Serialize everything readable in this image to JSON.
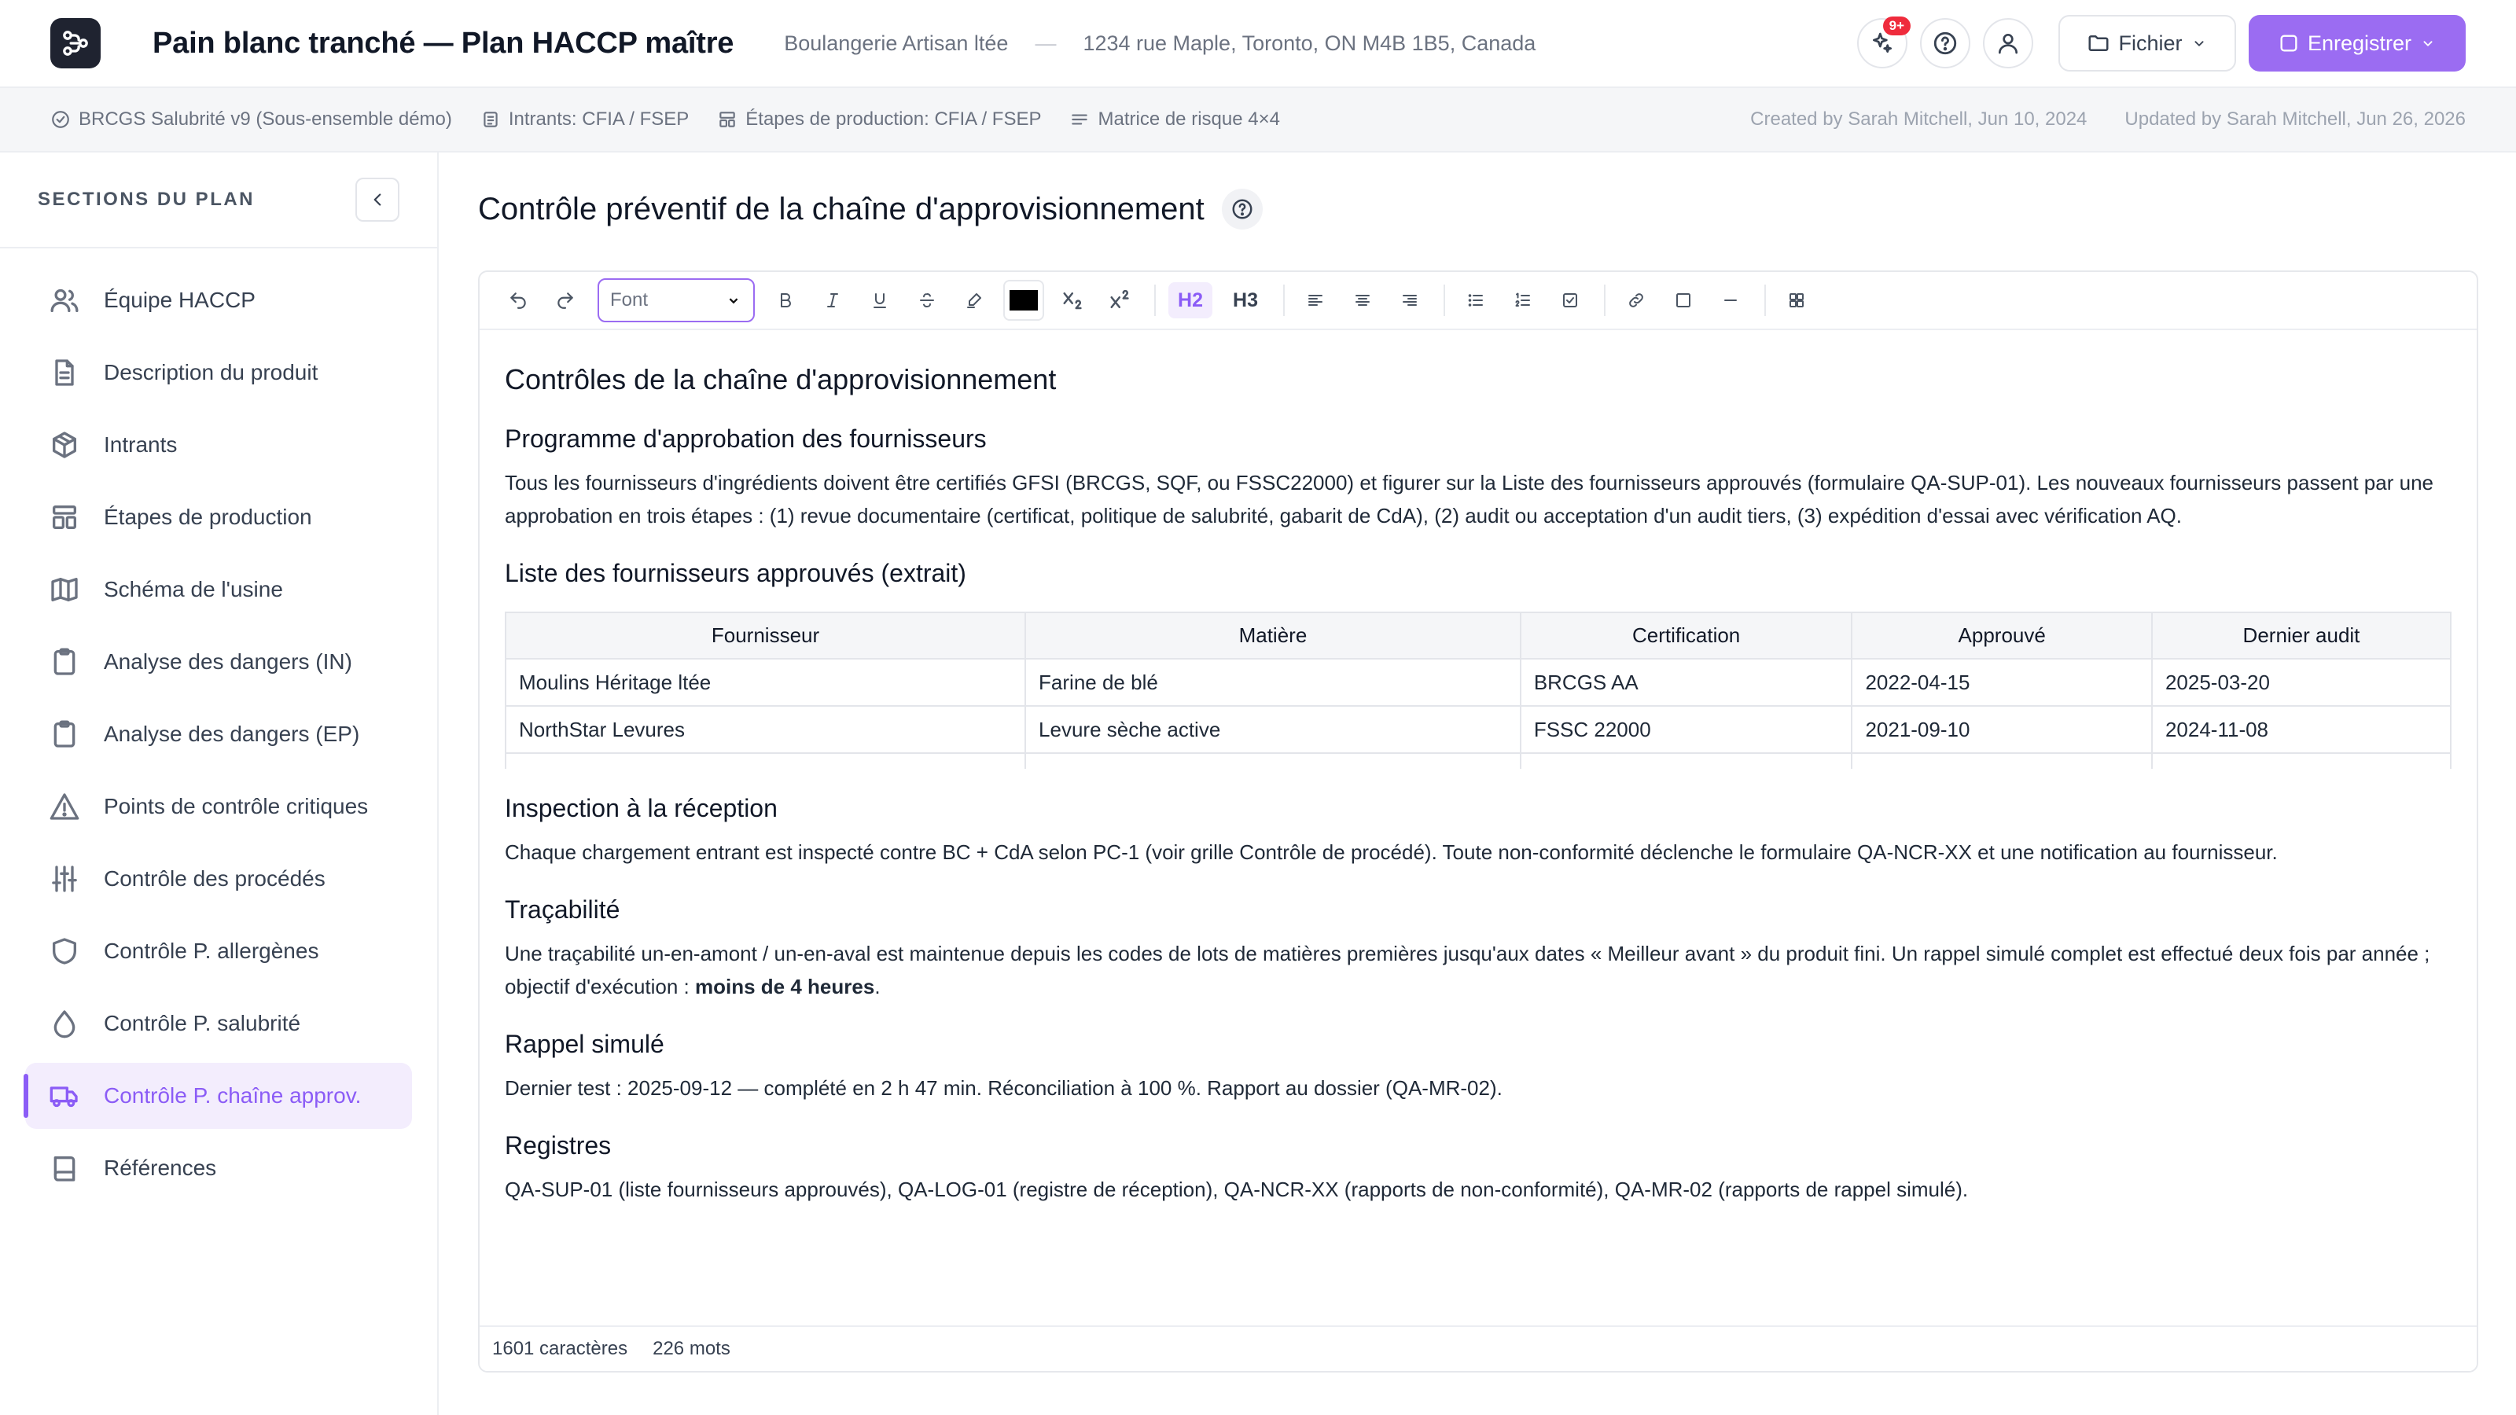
{
  "header": {
    "plan_title": "Pain blanc tranché — Plan HACCP maître",
    "company": "Boulangerie Artisan ltée",
    "separator": "—",
    "address": "1234 rue Maple, Toronto, ON M4B 1B5, Canada",
    "notif_badge": "9+",
    "file_label": "Fichier",
    "save_label": "Enregistrer"
  },
  "metabar": {
    "items": [
      "BRCGS Salubrité v9 (Sous-ensemble démo)",
      "Intrants: CFIA / FSEP",
      "Étapes de production: CFIA / FSEP",
      "Matrice de risque 4×4"
    ],
    "created": "Created by Sarah Mitchell, Jun 10, 2024",
    "updated": "Updated by Sarah Mitchell, Jun 26, 2026"
  },
  "sidebar": {
    "title": "SECTIONS DU PLAN",
    "items": [
      {
        "label": "Équipe HACCP",
        "icon": "users-icon"
      },
      {
        "label": "Description du produit",
        "icon": "document-icon"
      },
      {
        "label": "Intrants",
        "icon": "package-icon"
      },
      {
        "label": "Étapes de production",
        "icon": "layout-icon"
      },
      {
        "label": "Schéma de l'usine",
        "icon": "map-icon"
      },
      {
        "label": "Analyse des dangers (IN)",
        "icon": "clipboard-icon"
      },
      {
        "label": "Analyse des dangers (EP)",
        "icon": "clipboard-icon"
      },
      {
        "label": "Points de contrôle critiques",
        "icon": "warning-icon"
      },
      {
        "label": "Contrôle des procédés",
        "icon": "sliders-icon"
      },
      {
        "label": "Contrôle P. allergènes",
        "icon": "shield-icon"
      },
      {
        "label": "Contrôle P. salubrité",
        "icon": "droplet-icon"
      },
      {
        "label": "Contrôle P. chaîne approv.",
        "icon": "truck-icon"
      },
      {
        "label": "Références",
        "icon": "book-icon"
      }
    ]
  },
  "main": {
    "section_title": "Contrôle préventif de la chaîne d'approvisionnement",
    "font_select": "Font",
    "h2_label": "H2",
    "h3_label": "H3",
    "doc": {
      "h1": "Contrôles de la chaîne d'approvisionnement",
      "s1_title": "Programme d'approbation des fournisseurs",
      "s1_text": "Tous les fournisseurs d'ingrédients doivent être certifiés GFSI (BRCGS, SQF, ou FSSC22000) et figurer sur la Liste des fournisseurs approuvés (formulaire QA-SUP-01). Les nouveaux fournisseurs passent par une approbation en trois étapes : (1) revue documentaire (certificat, politique de salubrité, gabarit de CdA), (2) audit ou acceptation d'un audit tiers, (3) expédition d'essai avec vérification AQ.",
      "s2_title": "Liste des fournisseurs approuvés (extrait)",
      "table": {
        "headers": [
          "Fournisseur",
          "Matière",
          "Certification",
          "Approuvé",
          "Dernier audit"
        ],
        "rows": [
          [
            "Moulins Héritage ltée",
            "Farine de blé",
            "BRCGS AA",
            "2022-04-15",
            "2025-03-20"
          ],
          [
            "NorthStar Levures",
            "Levure sèche active",
            "FSSC 22000",
            "2021-09-10",
            "2024-11-08"
          ]
        ]
      },
      "s3_title": "Inspection à la réception",
      "s3_text": "Chaque chargement entrant est inspecté contre BC + CdA selon PC-1 (voir grille Contrôle de procédé). Toute non-conformité déclenche le formulaire QA-NCR-XX et une notification au fournisseur.",
      "s4_title": "Traçabilité",
      "s4_text": "Une traçabilité un-en-amont / un-en-aval est maintenue depuis les codes de lots de matières premières jusqu'aux dates « Meilleur avant » du produit fini. Un rappel simulé complet est effectué deux fois par année ; objectif d'exécution : ",
      "s4_bold": "moins de 4 heures",
      "s4_end": ".",
      "s5_title": "Rappel simulé",
      "s5_text": "Dernier test : 2025-09-12 — complété en 2 h 47 min. Réconciliation à 100 %. Rapport au dossier (QA-MR-02).",
      "s6_title": "Registres",
      "s6_text": "QA-SUP-01 (liste fournisseurs approuvés), QA-LOG-01 (registre de réception), QA-NCR-XX (rapports de non-conformité), QA-MR-02 (rapports de rappel simulé)."
    },
    "status": {
      "chars": "1601 caractères",
      "words": "226 mots"
    }
  },
  "colors": {
    "accent": "#9b6cf2",
    "active_bg": "#f3edfd",
    "badge": "#ef2b3c"
  }
}
